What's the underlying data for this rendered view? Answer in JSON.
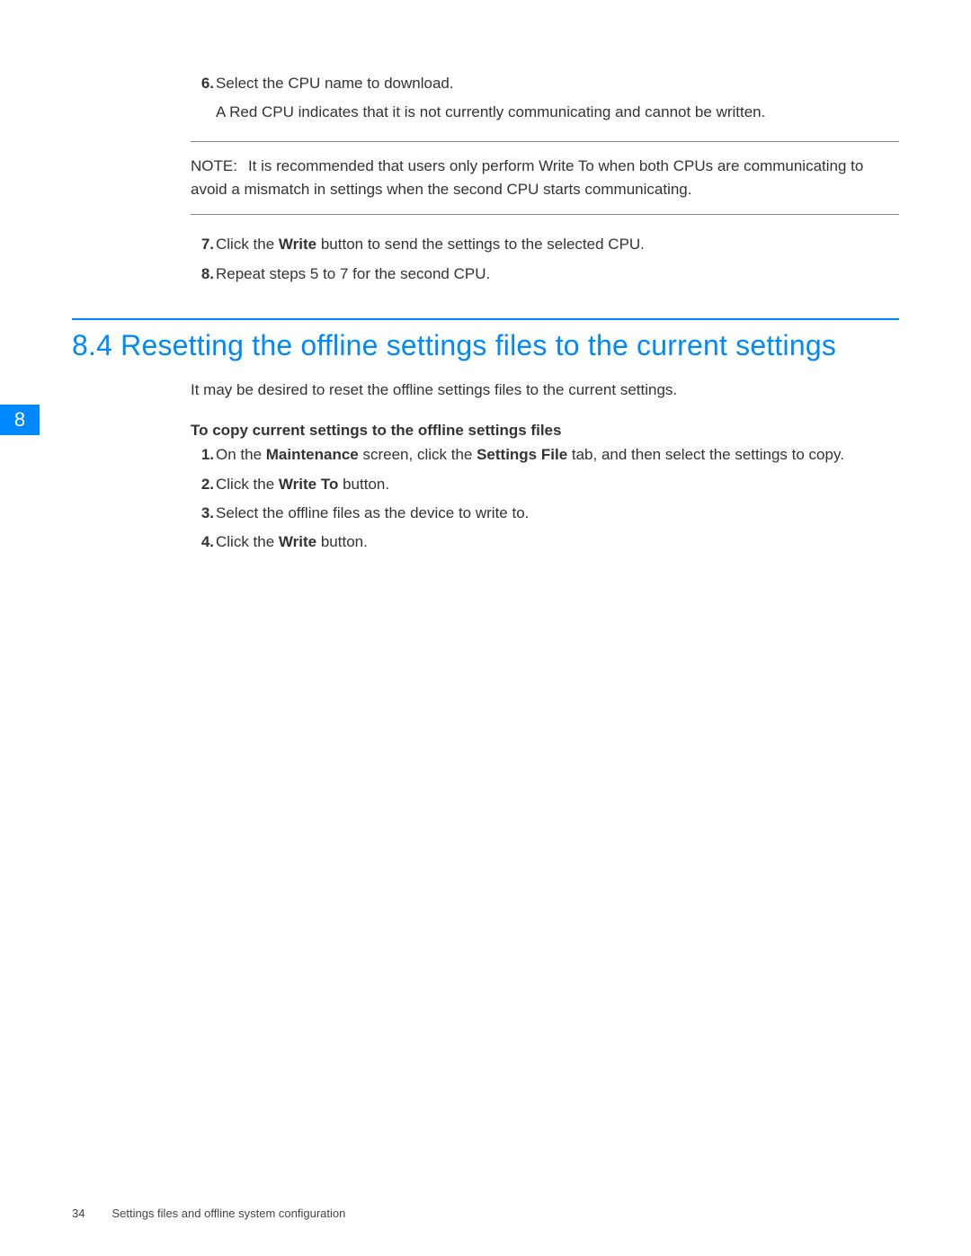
{
  "chapter_tab": "8",
  "steps_a": {
    "item_6_num": "6.",
    "item_6_text": "Select the CPU name to download.",
    "item_6_sub": "A Red CPU indicates that it is not currently communicating and cannot be written."
  },
  "note": {
    "label": "NOTE:",
    "text": "It is recommended that users only perform Write To when both CPUs are communicating to avoid a mismatch in settings when the second CPU starts communicating."
  },
  "steps_b": {
    "item_7_num": "7.",
    "item_7_pre": "Click the ",
    "item_7_bold": "Write",
    "item_7_post": " button to send the settings to the selected CPU.",
    "item_8_num": "8.",
    "item_8_text": "Repeat steps 5 to 7 for the second CPU."
  },
  "section": {
    "heading": "8.4 Resetting the offline settings files to the current settings",
    "intro": "It may be desired to reset the offline settings files to the current settings.",
    "sub_heading": "To copy current settings to the offline settings files",
    "s1_num": "1.",
    "s1_pre": "On the ",
    "s1_b1": "Maintenance",
    "s1_mid": " screen, click the ",
    "s1_b2": "Settings File",
    "s1_post": " tab, and then select the settings to copy.",
    "s2_num": "2.",
    "s2_pre": "Click the ",
    "s2_b": "Write To",
    "s2_post": " button.",
    "s3_num": "3.",
    "s3_text": "Select the offline files as the device to write to.",
    "s4_num": "4.",
    "s4_pre": "Click the ",
    "s4_b": "Write",
    "s4_post": " button."
  },
  "footer": {
    "page": "34",
    "title": "Settings files and offline system configuration"
  }
}
